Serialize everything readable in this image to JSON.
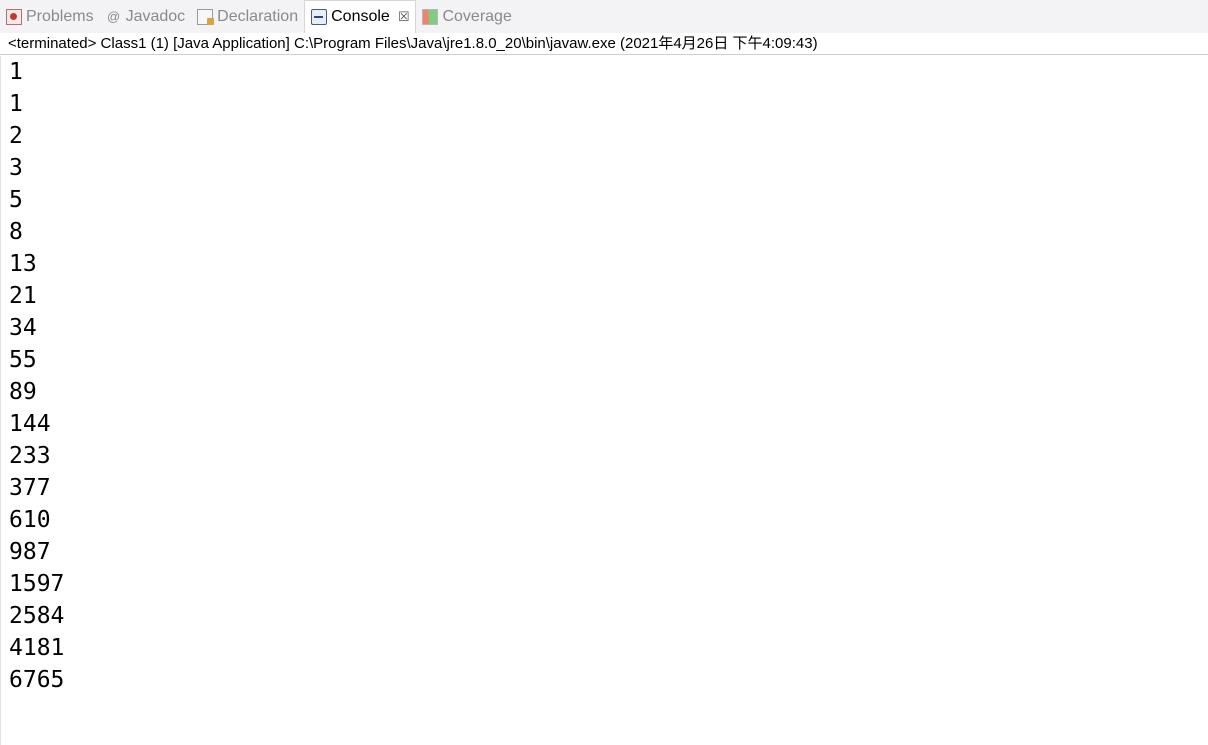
{
  "tabs": {
    "problems": {
      "label": "Problems",
      "icon": "problems-icon"
    },
    "javadoc": {
      "label": "Javadoc",
      "icon": "at-icon",
      "glyph": "@"
    },
    "declaration": {
      "label": "Declaration",
      "icon": "declaration-icon"
    },
    "console": {
      "label": "Console",
      "icon": "console-icon",
      "close": "☒"
    },
    "coverage": {
      "label": "Coverage",
      "icon": "coverage-icon"
    }
  },
  "status": "<terminated> Class1 (1) [Java Application] C:\\Program Files\\Java\\jre1.8.0_20\\bin\\javaw.exe (2021年4月26日 下午4:09:43)",
  "output": [
    "1",
    "1",
    "2",
    "3",
    "5",
    "8",
    "13",
    "21",
    "34",
    "55",
    "89",
    "144",
    "233",
    "377",
    "610",
    "987",
    "1597",
    "2584",
    "4181",
    "6765"
  ]
}
